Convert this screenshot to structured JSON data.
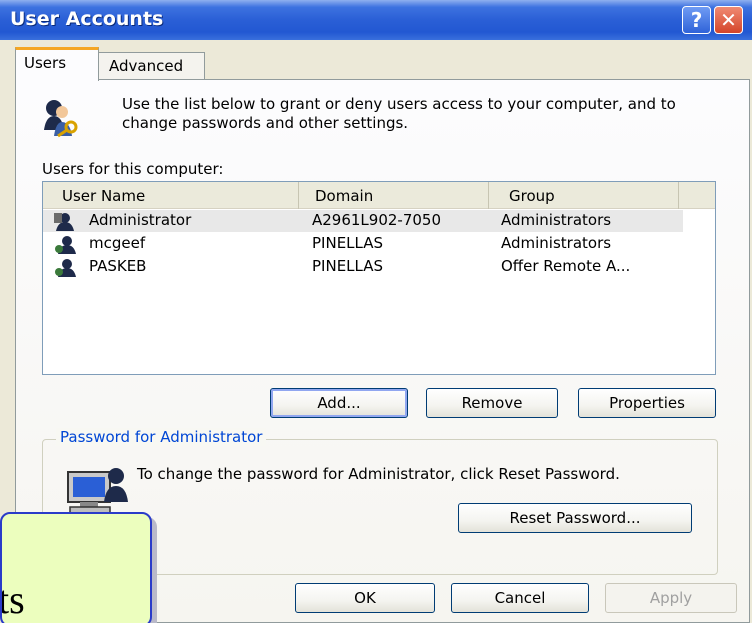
{
  "window": {
    "title": "User Accounts",
    "help_symbol": "?",
    "close_symbol": "✕"
  },
  "tabs": [
    {
      "label": "Users",
      "active": true
    },
    {
      "label": "Advanced",
      "active": false
    }
  ],
  "intro": {
    "icon": "users-keys-icon",
    "text": "Use the list below to grant or deny users access to your computer, and to change passwords and other settings."
  },
  "users_list": {
    "label": "Users for this computer:",
    "columns": [
      "User Name",
      "Domain",
      "Group"
    ],
    "rows": [
      {
        "name": "Administrator",
        "domain": "A2961L902-7050",
        "group": "Administrators",
        "icon": "admin-user-icon",
        "selected": true
      },
      {
        "name": "mcgeef",
        "domain": "PINELLAS",
        "group": "Administrators",
        "icon": "user-icon",
        "selected": false
      },
      {
        "name": "PASKEB",
        "domain": "PINELLAS",
        "group": "Offer Remote A...",
        "icon": "user-icon",
        "selected": false
      }
    ]
  },
  "list_buttons": {
    "add": "Add...",
    "remove": "Remove",
    "properties": "Properties"
  },
  "password_group": {
    "title": "Password for Administrator",
    "icon": "computer-user-icon",
    "text": "To change the password for Administrator, click Reset Password.",
    "reset_button": "Reset Password..."
  },
  "dialog_buttons": {
    "ok": "OK",
    "cancel": "Cancel",
    "apply": "Apply"
  },
  "overlay": {
    "text": "ts"
  },
  "colors": {
    "titlebar": "#2258d2",
    "dialog_bg": "#ece9d8",
    "tab_accent": "#f5a623",
    "group_title": "#0046d5",
    "overlay_bg": "#ecfebe",
    "overlay_border": "#2a3bc9"
  }
}
